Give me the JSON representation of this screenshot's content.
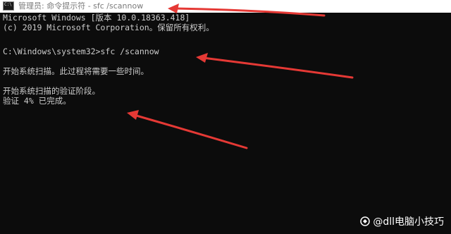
{
  "window": {
    "title": "管理员: 命令提示符 - sfc  /scannow",
    "icon": "cmd-icon"
  },
  "console": {
    "lines": [
      "Microsoft Windows [版本 10.0.18363.418]",
      "(c) 2019 Microsoft Corporation。保留所有权利。",
      "",
      "C:\\Windows\\system32>sfc /scannow",
      "",
      "开始系统扫描。此过程将需要一些时间。",
      "",
      "开始系统扫描的验证阶段。",
      "验证 4% 已完成。"
    ],
    "progress_percent": 4
  },
  "watermark": {
    "text": "@dll电脑小技巧"
  },
  "colors": {
    "console_bg": "#0c0c0c",
    "console_text": "#cccccc",
    "arrow": "#e53935"
  }
}
